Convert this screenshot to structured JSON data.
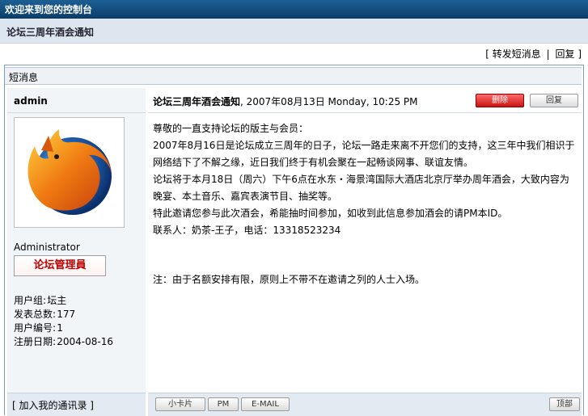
{
  "header": {
    "title": "欢迎来到您的控制台"
  },
  "subheader": {
    "title": "论坛三周年酒会通知"
  },
  "actions": {
    "forward": "转发短消息",
    "reply": "回复",
    "open": "[",
    "close": "]",
    "sep": "|"
  },
  "panel": {
    "title": "短消息"
  },
  "author": {
    "name": "admin",
    "role": "Administrator",
    "badge": "论坛管理員",
    "stats": [
      {
        "label": "用户组",
        "value": "坛主"
      },
      {
        "label": "发表总数",
        "value": "177"
      },
      {
        "label": "用户编号",
        "value": "1"
      },
      {
        "label": "注册日期",
        "value": "2004-08-16"
      }
    ],
    "add_contact": "[ 加入我的通讯录 ]"
  },
  "message": {
    "title": "论坛三周年酒会通知",
    "datetime": ", 2007年08月13日 Monday, 10:25 PM",
    "delete_label": "删除",
    "reply_label": "回复",
    "lines": [
      "尊敬的一直支持论坛的版主与会员：",
      "2007年8月16日是论坛成立三周年的日子，论坛一路走来离不开您们的支持，这三年中我们相识于网络结下了不解之缘，近日我们终于有机会聚在一起畅谈网事、联谊友情。",
      "论坛将于本月18日（周六）下午6点在水东・海景湾国际大酒店北京厅举办周年酒会，大致内容为晚宴、本土音乐、嘉宾表演节目、抽奖等。",
      "特此邀请您参与此次酒会，希能抽时间参加，如收到此信息参加酒会的请PM本ID。",
      "联系人：奶茶-王子，电话：13318523234"
    ],
    "note": "注：由于名额安排有限，原则上不带不在邀请之列的人士入场。"
  },
  "footer": {
    "card": "小卡片",
    "pm": "PM",
    "email": "E-MAIL",
    "top": "顶部"
  },
  "colors": {
    "topbar": "#0b3f6c",
    "subbar": "#dde6ef",
    "delete": "#c81414"
  }
}
